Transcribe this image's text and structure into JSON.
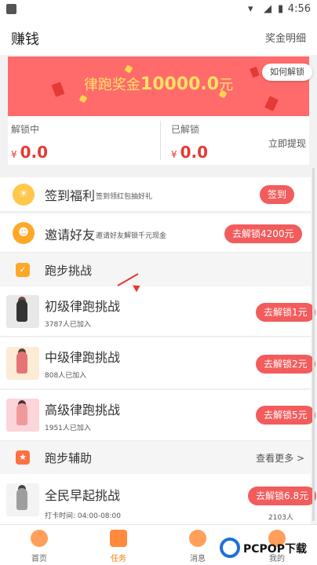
{
  "status_bar": {
    "time": "4:56"
  },
  "header": {
    "title": "赚钱",
    "detail_link": "奖金明细"
  },
  "banner": {
    "prefix": "律跑奖金",
    "amount": "10000.0",
    "suffix": "元",
    "howto_label": "如何解锁"
  },
  "balance": {
    "locked_label": "解锁中",
    "locked_currency": "¥",
    "locked_amount": "0.0",
    "unlocked_label": "已解锁",
    "unlocked_currency": "¥",
    "unlocked_amount": "0.0",
    "withdraw_label": "立即提现"
  },
  "tasks": [
    {
      "name": "签到福利",
      "desc": "签到领红包抽好礼",
      "button": "签到"
    },
    {
      "name": "邀请好友",
      "desc": "邀请好友解锁千元现金",
      "button": "去解锁4200元"
    }
  ],
  "section_running": {
    "label": "跑步挑战"
  },
  "challenges": [
    {
      "name": "初级律跑挑战",
      "joined": "3787人已加入",
      "button": "去解锁1元"
    },
    {
      "name": "中级律跑挑战",
      "joined": "808人已加入",
      "button": "去解锁2元"
    },
    {
      "name": "高级律跑挑战",
      "joined": "1951人已加入",
      "button": "去解锁5元"
    }
  ],
  "section_assist": {
    "label": "跑步辅助",
    "more": "查看更多 >"
  },
  "early_rise": {
    "name": "全民早起挑战",
    "time": "打卡时间: 04:00-08:00",
    "count": "2103人",
    "button": "去解锁6.8元"
  },
  "tabs": [
    {
      "label": "首页"
    },
    {
      "label": "任务"
    },
    {
      "label": "消息"
    },
    {
      "label": "我的"
    }
  ],
  "watermark": {
    "brand": "PCPOP下载"
  },
  "colors": {
    "accent": "#f25c5c",
    "banner": "#ff6b6b",
    "banner_text": "#ffe066",
    "active_tab": "#f57c00"
  }
}
